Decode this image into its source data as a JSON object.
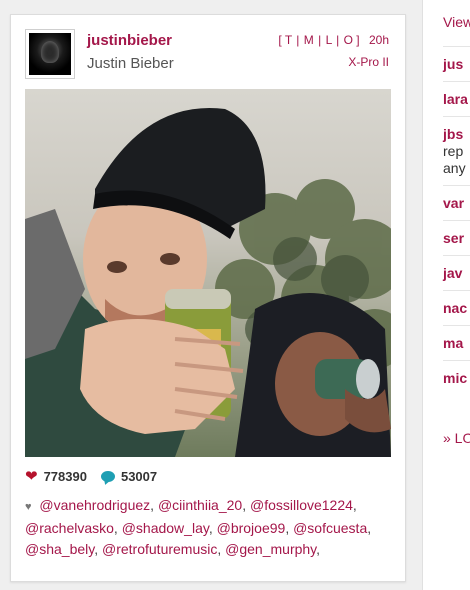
{
  "post": {
    "username": "justinbieber",
    "full_name": "Justin Bieber",
    "links": [
      "T",
      "M",
      "L",
      "O"
    ],
    "time": "20h",
    "filter": "X-Pro II",
    "likes": "778390",
    "comments": "53007",
    "likers": [
      "@vanehrodriguez",
      "@ciinthiia_20",
      "@fossillove1224",
      "@rachelvasko",
      "@shadow_lay",
      "@brojoe99",
      "@sofcuesta",
      "@sha_bely",
      "@retrofuturemusic",
      "@gen_murphy"
    ]
  },
  "sidebar": {
    "view_label": "View",
    "comments": [
      {
        "user": "jus",
        "text": ""
      },
      {
        "user": "lara",
        "text": ""
      },
      {
        "user": "jbs",
        "text": "rep any"
      },
      {
        "user": "var",
        "text": ""
      },
      {
        "user": "ser",
        "text": ""
      },
      {
        "user": "jav",
        "text": ""
      },
      {
        "user": "nac",
        "text": ""
      },
      {
        "user": "ma",
        "text": ""
      },
      {
        "user": "mic",
        "text": ""
      }
    ],
    "more_label": "» LO"
  },
  "colors": {
    "accent": "#a4174a",
    "heart": "#b5122c",
    "bubble": "#1f9fb3"
  }
}
